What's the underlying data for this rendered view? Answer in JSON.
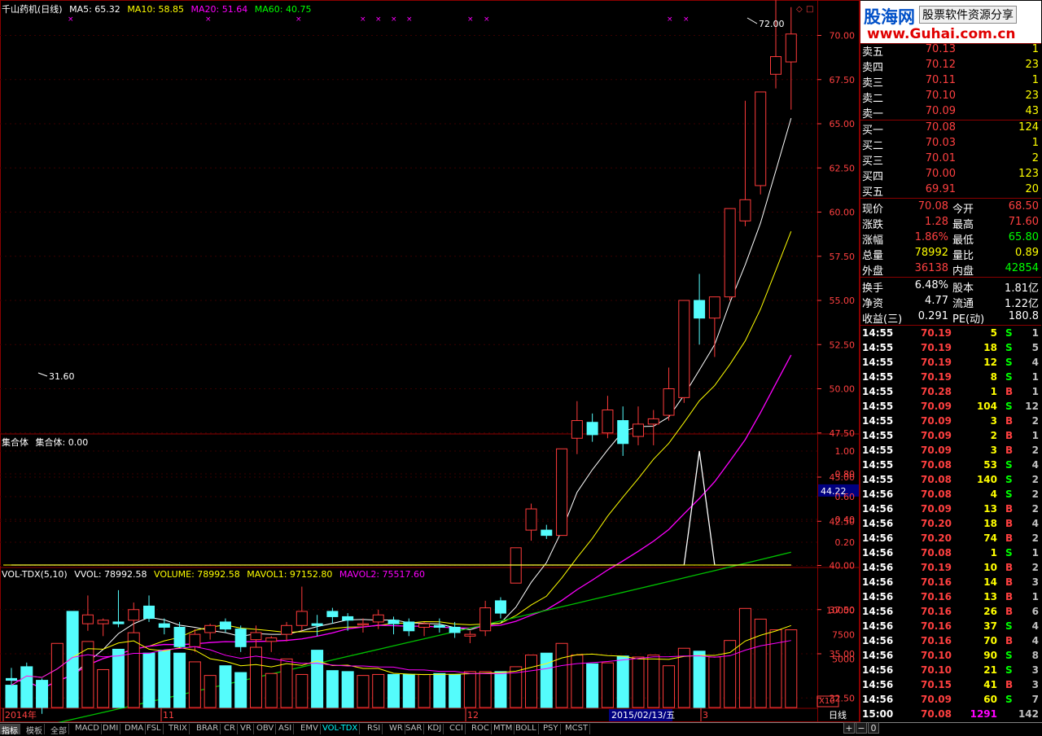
{
  "header": {
    "stock_name": "千山药机(日线)",
    "ma5": "MA5: 65.32",
    "ma10": "MA10: 58.85",
    "ma20": "MA20: 51.64",
    "ma60": "MA60: 40.75",
    "indicator1": "集合体",
    "indicator1_value": "集合体: 0.00",
    "vol_title": "VOL-TDX(5,10)",
    "vvol": "VVOL: 78992.58",
    "volume": "VOLUME: 78992.58",
    "mavol1": "MAVOL1: 97152.80",
    "mavol2": "MAVOL2: 75517.60"
  },
  "price_axis": [
    "70.00",
    "67.50",
    "65.00",
    "62.50",
    "60.00",
    "57.50",
    "55.00",
    "52.50",
    "50.00",
    "47.50",
    "45.00",
    "42.50",
    "40.00",
    "37.50",
    "35.00",
    "32.50",
    "30.00"
  ],
  "current_price_tag": "44.22",
  "high_label": "72.00",
  "low_label": "31.60",
  "ind_axis": [
    "1.00",
    "0.80",
    "0.60",
    "0.40",
    "0.20"
  ],
  "vol_axis": [
    "10000",
    "7500",
    "5000"
  ],
  "vol_unit": "X10",
  "date_labels": {
    "d1": "2014年",
    "d2": "11",
    "d3": "12",
    "d4": "3"
  },
  "cursor_date": "2015/02/13/五",
  "period_label": "日线",
  "colors": {
    "up": "#ff3b3b",
    "down": "#54fcfc",
    "ma5": "#ffffff",
    "ma10": "#ffff00",
    "ma20": "#ff00ff",
    "ma60": "#00c000"
  },
  "banner": {
    "title": "股海网",
    "sub": "股票软件资源分享",
    "url": "www.Guhai.com.cn"
  },
  "order_book": {
    "sell": [
      {
        "label": "卖五",
        "price": "70.13",
        "vol": "1"
      },
      {
        "label": "卖四",
        "price": "70.12",
        "vol": "23"
      },
      {
        "label": "卖三",
        "price": "70.11",
        "vol": "1"
      },
      {
        "label": "卖二",
        "price": "70.10",
        "vol": "23"
      },
      {
        "label": "卖一",
        "price": "70.09",
        "vol": "43"
      }
    ],
    "buy": [
      {
        "label": "买一",
        "price": "70.08",
        "vol": "124"
      },
      {
        "label": "买二",
        "price": "70.03",
        "vol": "1"
      },
      {
        "label": "买三",
        "price": "70.01",
        "vol": "2"
      },
      {
        "label": "买四",
        "price": "70.00",
        "vol": "123"
      },
      {
        "label": "买五",
        "price": "69.91",
        "vol": "20"
      }
    ]
  },
  "quote": [
    {
      "l1": "现价",
      "v1": "70.08",
      "l2": "今开",
      "v2": "68.50"
    },
    {
      "l1": "涨跌",
      "v1": "1.28",
      "l2": "最高",
      "v2": "71.60"
    },
    {
      "l1": "涨幅",
      "v1": "1.86%",
      "l2": "最低",
      "v2": "65.80"
    },
    {
      "l1": "总量",
      "v1": "78992",
      "l2": "量比",
      "v2": "0.89"
    },
    {
      "l1": "外盘",
      "v1": "36138",
      "l2": "内盘",
      "v2": "42854"
    }
  ],
  "finance": [
    {
      "l1": "换手",
      "v1": "6.48%",
      "l2": "股本",
      "v2": "1.81亿"
    },
    {
      "l1": "净资",
      "v1": "4.77",
      "l2": "流通",
      "v2": "1.22亿"
    },
    {
      "l1": "收益(三)",
      "v1": "0.291",
      "l2": "PE(动)",
      "v2": "180.8"
    }
  ],
  "ticks": [
    [
      "14:55",
      "70.19",
      "5",
      "S",
      "1"
    ],
    [
      "14:55",
      "70.19",
      "18",
      "S",
      "5"
    ],
    [
      "14:55",
      "70.19",
      "12",
      "S",
      "4"
    ],
    [
      "14:55",
      "70.19",
      "8",
      "S",
      "1"
    ],
    [
      "14:55",
      "70.28",
      "1",
      "B",
      "1"
    ],
    [
      "14:55",
      "70.09",
      "104",
      "S",
      "12"
    ],
    [
      "14:55",
      "70.09",
      "3",
      "B",
      "2"
    ],
    [
      "14:55",
      "70.09",
      "2",
      "B",
      "1"
    ],
    [
      "14:55",
      "70.09",
      "3",
      "B",
      "2"
    ],
    [
      "14:55",
      "70.08",
      "53",
      "S",
      "4"
    ],
    [
      "14:55",
      "70.08",
      "140",
      "S",
      "2"
    ],
    [
      "14:56",
      "70.08",
      "4",
      "S",
      "2"
    ],
    [
      "14:56",
      "70.09",
      "13",
      "B",
      "2"
    ],
    [
      "14:56",
      "70.20",
      "18",
      "B",
      "4"
    ],
    [
      "14:56",
      "70.20",
      "74",
      "B",
      "2"
    ],
    [
      "14:56",
      "70.08",
      "1",
      "S",
      "1"
    ],
    [
      "14:56",
      "70.19",
      "10",
      "B",
      "2"
    ],
    [
      "14:56",
      "70.16",
      "14",
      "B",
      "3"
    ],
    [
      "14:56",
      "70.16",
      "13",
      "B",
      "1"
    ],
    [
      "14:56",
      "70.16",
      "26",
      "B",
      "6"
    ],
    [
      "14:56",
      "70.16",
      "37",
      "S",
      "4"
    ],
    [
      "14:56",
      "70.16",
      "70",
      "B",
      "4"
    ],
    [
      "14:56",
      "70.10",
      "90",
      "S",
      "8"
    ],
    [
      "14:56",
      "70.10",
      "21",
      "S",
      "3"
    ],
    [
      "14:56",
      "70.15",
      "41",
      "B",
      "3"
    ],
    [
      "14:56",
      "70.09",
      "60",
      "S",
      "7"
    ],
    [
      "15:00",
      "70.08",
      "1291",
      "",
      "142"
    ]
  ],
  "tabs": [
    "指标",
    "模板",
    "全部",
    "MACD",
    "DMI",
    "DMA",
    "FSL",
    "TRIX",
    "BRAR",
    "CR",
    "VR",
    "OBV",
    "ASI",
    "EMV",
    "VOL-TDX",
    "RSI",
    "WR",
    "SAR",
    "KDJ",
    "CCI",
    "ROC",
    "MTM",
    "BOLL",
    "PSY",
    "MCST"
  ],
  "nav_buttons": [
    "+",
    "−",
    "0"
  ],
  "chart_data": {
    "type": "candlestick",
    "x_labels": [
      "2014年",
      "11",
      "12",
      "2015/02/13",
      "3"
    ],
    "candles": [
      {
        "o": 33.6,
        "h": 34.2,
        "l": 33.2,
        "c": 33.5
      },
      {
        "o": 34.2,
        "h": 34.5,
        "l": 33.0,
        "c": 33.4
      },
      {
        "o": 33.3,
        "h": 33.6,
        "l": 31.6,
        "c": 32.2
      },
      {
        "o": 32.8,
        "h": 35.0,
        "l": 32.6,
        "c": 34.7
      },
      {
        "o": 36.0,
        "h": 36.2,
        "l": 34.6,
        "c": 35.2
      },
      {
        "o": 36.7,
        "h": 38.3,
        "l": 36.3,
        "c": 37.2
      },
      {
        "o": 36.7,
        "h": 37.0,
        "l": 36.0,
        "c": 36.9
      },
      {
        "o": 36.8,
        "h": 38.6,
        "l": 36.5,
        "c": 36.7
      },
      {
        "o": 36.9,
        "h": 37.9,
        "l": 35.8,
        "c": 37.5
      },
      {
        "o": 37.7,
        "h": 38.3,
        "l": 36.8,
        "c": 37.0
      },
      {
        "o": 36.7,
        "h": 37.0,
        "l": 36.1,
        "c": 36.5
      },
      {
        "o": 36.5,
        "h": 36.8,
        "l": 35.3,
        "c": 35.4
      },
      {
        "o": 35.4,
        "h": 36.4,
        "l": 35.1,
        "c": 36.1
      },
      {
        "o": 36.2,
        "h": 36.7,
        "l": 35.8,
        "c": 36.6
      },
      {
        "o": 36.8,
        "h": 37.0,
        "l": 36.2,
        "c": 36.4
      },
      {
        "o": 36.4,
        "h": 36.6,
        "l": 35.1,
        "c": 35.4
      },
      {
        "o": 35.8,
        "h": 36.6,
        "l": 35.1,
        "c": 36.2
      },
      {
        "o": 35.7,
        "h": 36.0,
        "l": 35.1,
        "c": 35.9
      },
      {
        "o": 36.1,
        "h": 36.8,
        "l": 35.7,
        "c": 36.6
      },
      {
        "o": 36.6,
        "h": 38.8,
        "l": 36.3,
        "c": 37.4
      },
      {
        "o": 36.7,
        "h": 37.2,
        "l": 36.0,
        "c": 36.6
      },
      {
        "o": 37.4,
        "h": 37.6,
        "l": 36.7,
        "c": 37.1
      },
      {
        "o": 37.1,
        "h": 37.3,
        "l": 36.3,
        "c": 36.9
      },
      {
        "o": 36.7,
        "h": 37.0,
        "l": 36.2,
        "c": 36.7
      },
      {
        "o": 36.8,
        "h": 37.5,
        "l": 36.4,
        "c": 37.2
      },
      {
        "o": 36.9,
        "h": 37.1,
        "l": 36.1,
        "c": 36.7
      },
      {
        "o": 36.8,
        "h": 37.0,
        "l": 36.0,
        "c": 36.3
      },
      {
        "o": 36.5,
        "h": 36.8,
        "l": 36.0,
        "c": 36.7
      },
      {
        "o": 36.6,
        "h": 37.0,
        "l": 36.2,
        "c": 36.5
      },
      {
        "o": 36.5,
        "h": 36.8,
        "l": 35.9,
        "c": 36.2
      },
      {
        "o": 36.0,
        "h": 36.3,
        "l": 35.6,
        "c": 36.1
      },
      {
        "o": 36.3,
        "h": 38.0,
        "l": 36.0,
        "c": 37.6
      },
      {
        "o": 38.0,
        "h": 38.2,
        "l": 37.0,
        "c": 37.3
      },
      {
        "o": 39.0,
        "h": 41.0,
        "l": 39.0,
        "c": 41.0
      },
      {
        "o": 42.0,
        "h": 43.5,
        "l": 41.4,
        "c": 43.2
      },
      {
        "o": 42.0,
        "h": 42.3,
        "l": 41.5,
        "c": 41.7
      },
      {
        "o": 41.7,
        "h": 46.6,
        "l": 41.7,
        "c": 46.6
      },
      {
        "o": 47.2,
        "h": 49.3,
        "l": 46.3,
        "c": 48.2
      },
      {
        "o": 48.1,
        "h": 48.6,
        "l": 47.0,
        "c": 47.4
      },
      {
        "o": 47.5,
        "h": 49.6,
        "l": 47.2,
        "c": 48.8
      },
      {
        "o": 48.2,
        "h": 49.0,
        "l": 46.2,
        "c": 46.9
      },
      {
        "o": 47.3,
        "h": 49.0,
        "l": 46.8,
        "c": 48.0
      },
      {
        "o": 48.0,
        "h": 48.8,
        "l": 46.8,
        "c": 48.3
      },
      {
        "o": 48.5,
        "h": 51.2,
        "l": 48.2,
        "c": 50.0
      },
      {
        "o": 49.5,
        "h": 51.2,
        "l": 49.2,
        "c": 55.0
      },
      {
        "o": 55.0,
        "h": 56.5,
        "l": 52.5,
        "c": 54.0
      },
      {
        "o": 54.0,
        "h": 55.0,
        "l": 51.8,
        "c": 55.2
      },
      {
        "o": 55.2,
        "h": 60.2,
        "l": 55.0,
        "c": 60.2
      },
      {
        "o": 59.5,
        "h": 66.3,
        "l": 59.2,
        "c": 60.7
      },
      {
        "o": 61.5,
        "h": 66.8,
        "l": 61.0,
        "c": 66.8
      },
      {
        "o": 67.8,
        "h": 72.0,
        "l": 67.0,
        "c": 68.8
      },
      {
        "o": 68.5,
        "h": 71.6,
        "l": 65.8,
        "c": 70.08
      }
    ],
    "ma5_end": 65.32,
    "ma10_end": 58.85,
    "ma20_end": 51.64,
    "ma60_end": 40.75,
    "indicator": {
      "name": "集合体",
      "peak_index": 45,
      "peak_value": 1.0
    },
    "volume": [
      2300,
      4200,
      2800,
      6600,
      9900,
      6800,
      3900,
      6000,
      7700,
      5600,
      5900,
      5600,
      4700,
      3300,
      4300,
      3600,
      6200,
      3500,
      5000,
      3400,
      5900,
      3800,
      3700,
      3300,
      3400,
      3400,
      3400,
      3400,
      3500,
      3400,
      3700,
      3700,
      3700,
      4200,
      5400,
      5600,
      6600,
      5400,
      4500,
      4600,
      5300,
      5200,
      5400,
      4300,
      6100,
      5800,
      5200,
      6900,
      10200,
      9100,
      8000,
      8000
    ],
    "mavol1_end": 9715.28,
    "mavol2_end": 7551.76
  }
}
